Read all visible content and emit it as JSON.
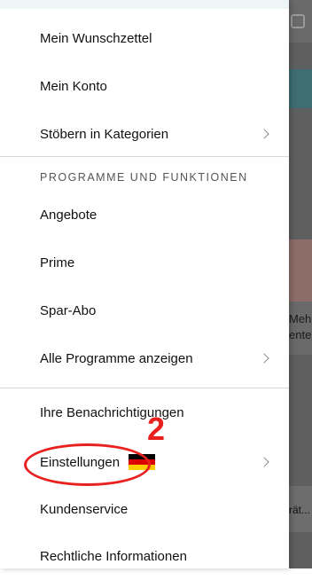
{
  "background": {
    "text_line1": "Meh",
    "text_line2": "ente",
    "bar_text": "rät..."
  },
  "menu": {
    "items_top": [
      {
        "label": "Mein Wunschzettel"
      },
      {
        "label": "Mein Konto"
      },
      {
        "label": "Stöbern in Kategorien"
      }
    ],
    "section_header": "PROGRAMME UND FUNKTIONEN",
    "programs": [
      {
        "label": "Angebote"
      },
      {
        "label": "Prime"
      },
      {
        "label": "Spar-Abo"
      },
      {
        "label": "Alle Programme anzeigen"
      }
    ],
    "settings_items": [
      {
        "label": "Ihre Benachrichtigungen"
      },
      {
        "label": "Einstellungen"
      },
      {
        "label": "Kundenservice"
      },
      {
        "label": "Rechtliche Informationen"
      }
    ]
  },
  "annotation": {
    "number": "2",
    "color": "#e8211f"
  },
  "icons": {
    "flag": "germany-flag-icon",
    "chevron": "chevron-right-icon"
  }
}
